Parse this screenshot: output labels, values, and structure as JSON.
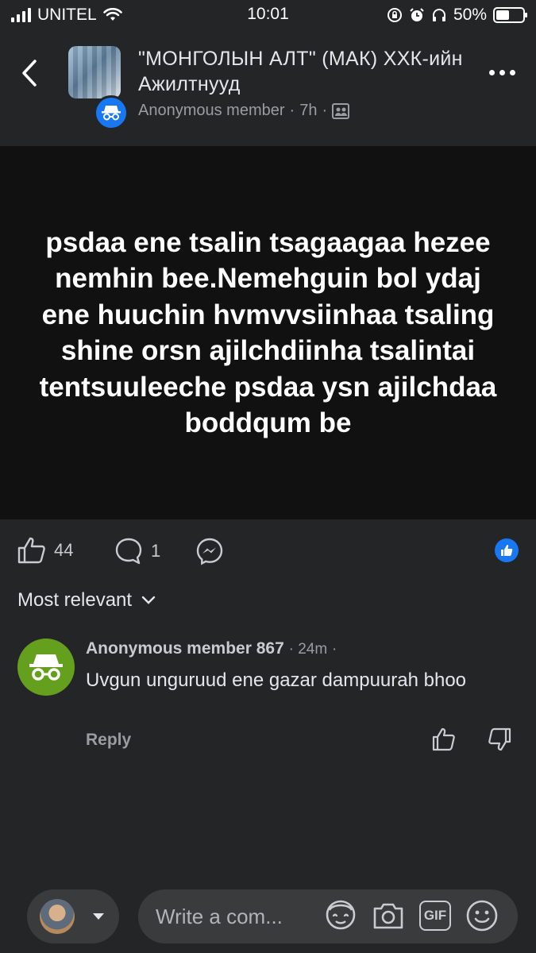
{
  "status_bar": {
    "carrier": "UNITEL",
    "time": "10:01",
    "battery_percent": "50%",
    "battery_level": 0.5
  },
  "header": {
    "group_name": "\"МОНГОЛЫН АЛТ\" (МАК) ХХК-ийн Ажилтнууд",
    "author": "Anonymous member",
    "time": "7h",
    "privacy_icon": "group-members-icon"
  },
  "post": {
    "text": "psdaa ene tsalin tsagaagaa hezee nemhin bee.Nemehguin bol ydaj ene huuchin hvmvvsiinhaa tsaling  shine orsn ajilchdiinha tsalintai tentsuuleeche psdaa ysn ajilchdaa boddqum be"
  },
  "actions": {
    "like_count": "44",
    "comment_count": "1"
  },
  "comments_sort": {
    "label": "Most relevant"
  },
  "comment": {
    "author": "Anonymous member 867",
    "time": "24m",
    "text": "Uvgun unguruud ene gazar dampuurah bhoo",
    "reply_label": "Reply"
  },
  "composer": {
    "placeholder": "Write a com...",
    "gif_label": "GIF"
  },
  "colors": {
    "background": "#242526",
    "post_background": "#111111",
    "accent_blue": "#1877f2",
    "anon_green": "#64a01e"
  }
}
